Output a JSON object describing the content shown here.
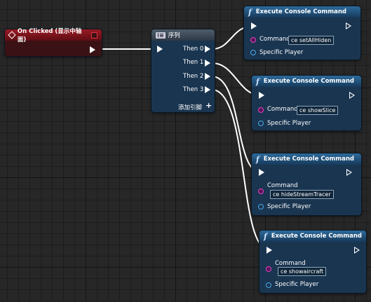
{
  "event": {
    "title": "On Clicked (显示中轴面)"
  },
  "sequence": {
    "title": "序列",
    "outputs": [
      "Then 0",
      "Then 1",
      "Then 2",
      "Then 3"
    ],
    "add_pin": "添加引脚"
  },
  "commands": [
    {
      "title": "Execute Console Command",
      "command_label": "Command",
      "command_value": "ce setAllHiden",
      "player_label": "Specific Player"
    },
    {
      "title": "Execute Console Command",
      "command_label": "Command",
      "command_value": "ce showSlice",
      "player_label": "Specific Player"
    },
    {
      "title": "Execute Console Command",
      "command_label": "Command",
      "command_value": "ce hideStreamTracer",
      "player_label": "Specific Player"
    },
    {
      "title": "Execute Console Command",
      "command_label": "Command",
      "command_value": "ce showaircraft",
      "player_label": "Specific Player"
    }
  ]
}
